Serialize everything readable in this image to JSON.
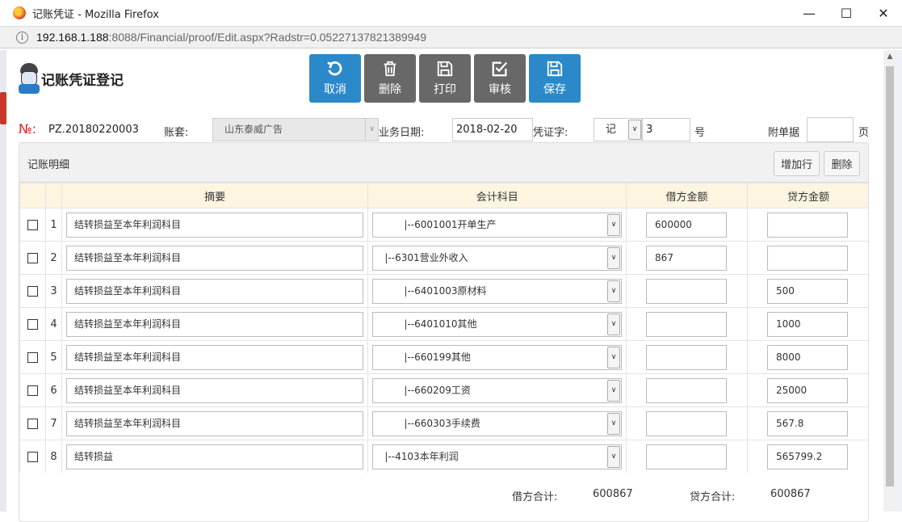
{
  "window": {
    "title": "记账凭证 - Mozilla Firefox",
    "url_host": "192.168.1.188",
    "url_rest": ":8088/Financial/proof/Edit.aspx?Radstr=0.05227137821389949",
    "minimize": "—",
    "maximize": "☐",
    "close": "✕"
  },
  "header": {
    "title": "记账凭证登记"
  },
  "toolbar": {
    "cancel": "取消",
    "delete": "删除",
    "print": "打印",
    "audit": "审核",
    "save": "保存"
  },
  "meta": {
    "no_label": "№:",
    "no_value": "PZ.20180220003",
    "ledger_label": "账套:",
    "ledger_value": "山东泰威广告",
    "date_label": "业务日期:",
    "date_value": "2018-02-20",
    "voucher_word_label": "凭证字:",
    "voucher_word_value": "记",
    "voucher_number": "3",
    "number_suffix": "号",
    "attachment_label": "附单据",
    "attachment_value": "",
    "page_suffix": "页"
  },
  "panel": {
    "title": "记账明细",
    "add_row": "增加行",
    "delete": "删除"
  },
  "table": {
    "headers": [
      "摘要",
      "会计科目",
      "借方金额",
      "贷方金额"
    ],
    "rows": [
      {
        "no": "1",
        "summary": "结转损益至本年利润科目",
        "account": "|--6001001开单生产",
        "indent": true,
        "debit": "600000",
        "credit": ""
      },
      {
        "no": "2",
        "summary": "结转损益至本年利润科目",
        "account": "|--6301营业外收入",
        "indent": false,
        "debit": "867",
        "credit": ""
      },
      {
        "no": "3",
        "summary": "结转损益至本年利润科目",
        "account": "|--6401003原材料",
        "indent": true,
        "debit": "",
        "credit": "500"
      },
      {
        "no": "4",
        "summary": "结转损益至本年利润科目",
        "account": "|--6401010其他",
        "indent": true,
        "debit": "",
        "credit": "1000"
      },
      {
        "no": "5",
        "summary": "结转损益至本年利润科目",
        "account": "|--660199其他",
        "indent": true,
        "debit": "",
        "credit": "8000"
      },
      {
        "no": "6",
        "summary": "结转损益至本年利润科目",
        "account": "|--660209工资",
        "indent": true,
        "debit": "",
        "credit": "25000"
      },
      {
        "no": "7",
        "summary": "结转损益至本年利润科目",
        "account": "|--660303手续费",
        "indent": true,
        "debit": "",
        "credit": "567.8"
      },
      {
        "no": "8",
        "summary": "结转损益",
        "account": "|--4103本年利润",
        "indent": false,
        "debit": "",
        "credit": "565799.2"
      }
    ]
  },
  "totals": {
    "debit_label": "借方合计:",
    "debit_value": "600867",
    "credit_label": "贷方合计:",
    "credit_value": "600867"
  }
}
